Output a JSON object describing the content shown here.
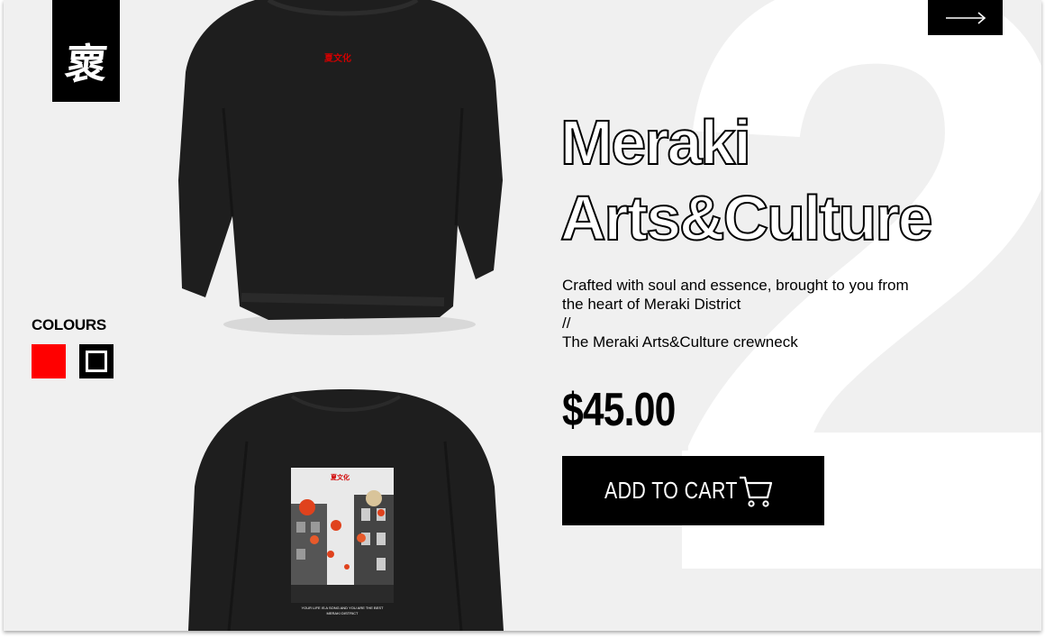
{
  "brand": {
    "logo_glyph": "褱"
  },
  "nav": {
    "next_icon": "arrow-right-icon"
  },
  "product": {
    "title_line1": "Meraki",
    "title_line2": "Arts&Culture",
    "background_number": "2",
    "description_line1": "Crafted with soul and essence, brought to you from",
    "description_line2": "the heart of Meraki District",
    "description_line3": "//",
    "description_line4": "The Meraki Arts&Culture crewneck",
    "price": "$45.00",
    "front_print": "夏文化",
    "back_print": "夏文化",
    "back_caption_line1": "YOUR LIFE IS A SONG AND YOU ARE THE BEST",
    "back_caption_line2": "MERAKI DISTRICT"
  },
  "colours": {
    "label": "COLOURS",
    "options": [
      {
        "name": "red",
        "hex": "#ff0000"
      },
      {
        "name": "black",
        "hex": "#000000"
      }
    ]
  },
  "cart": {
    "label": "ADD TO CART",
    "icon": "shopping-cart-icon"
  }
}
